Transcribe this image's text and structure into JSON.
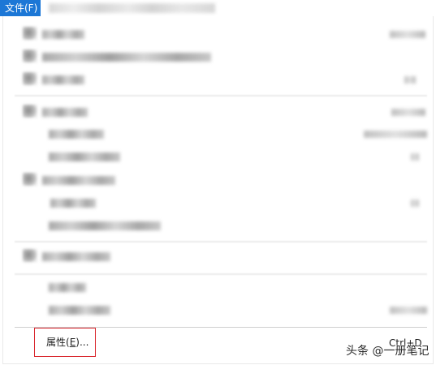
{
  "menubar": {
    "file_menu_label": "文件(F)"
  },
  "dropdown": {
    "properties_label_prefix": "属性(",
    "properties_label_mnemonic": "E",
    "properties_label_suffix": ")...",
    "properties_shortcut": "Ctrl+D"
  },
  "watermark": {
    "text": "头条 @一册笔记"
  }
}
